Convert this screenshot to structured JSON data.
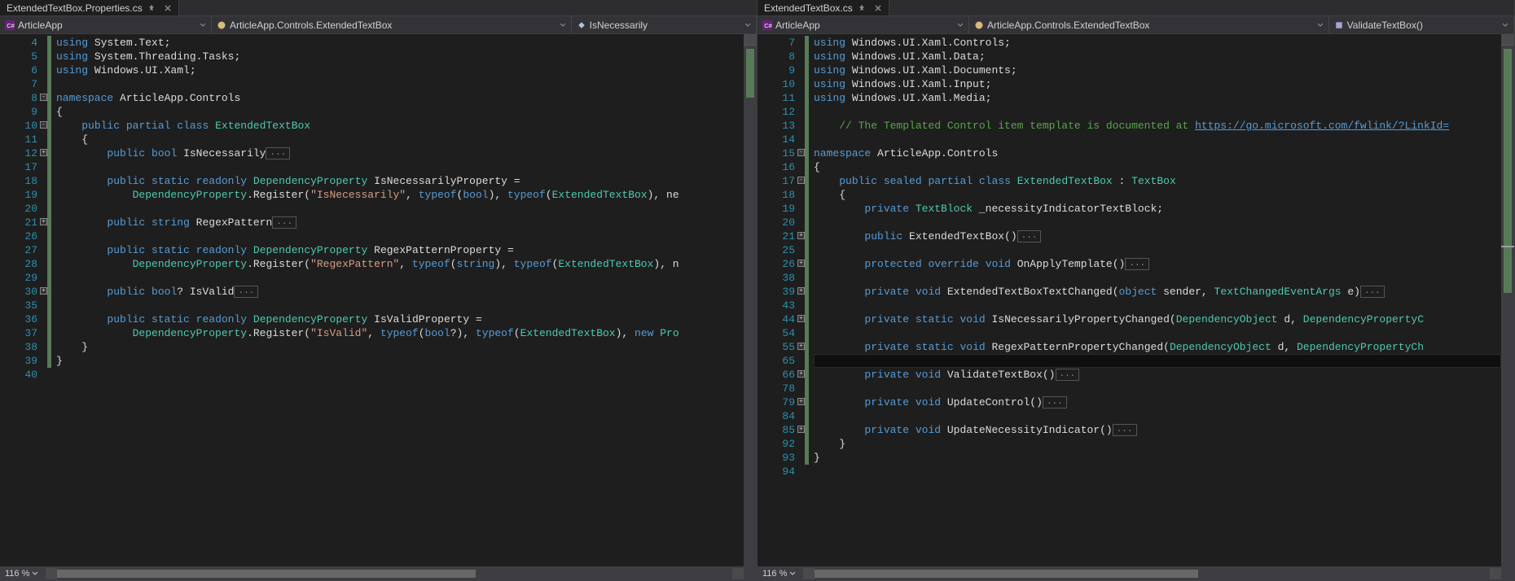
{
  "left": {
    "tab": {
      "title": "ExtendedTextBox.Properties.cs"
    },
    "nav": {
      "project": "ArticleApp",
      "class": "ArticleApp.Controls.ExtendedTextBox",
      "member": "IsNecessarily"
    },
    "zoom": "116 %",
    "lines": [
      {
        "num": 4,
        "green": true,
        "tokens": [
          [
            "kw",
            "using"
          ],
          [
            "pln",
            " System.Text;"
          ]
        ]
      },
      {
        "num": 5,
        "green": true,
        "tokens": [
          [
            "kw",
            "using"
          ],
          [
            "pln",
            " System.Threading.Tasks;"
          ]
        ]
      },
      {
        "num": 6,
        "green": true,
        "tokens": [
          [
            "kw",
            "using"
          ],
          [
            "pln",
            " Windows.UI.Xaml;"
          ]
        ]
      },
      {
        "num": 7,
        "green": true,
        "tokens": []
      },
      {
        "num": 8,
        "green": true,
        "fold": "-",
        "tokens": [
          [
            "kw",
            "namespace"
          ],
          [
            "pln",
            " ArticleApp.Controls"
          ]
        ]
      },
      {
        "num": 9,
        "green": true,
        "tokens": [
          [
            "pln",
            "{"
          ]
        ]
      },
      {
        "num": 10,
        "green": true,
        "fold": "-",
        "tokens": [
          [
            "pln",
            "    "
          ],
          [
            "kw",
            "public"
          ],
          [
            "pln",
            " "
          ],
          [
            "kw",
            "partial"
          ],
          [
            "pln",
            " "
          ],
          [
            "kw",
            "class"
          ],
          [
            "pln",
            " "
          ],
          [
            "cls",
            "ExtendedTextBox"
          ]
        ]
      },
      {
        "num": 11,
        "green": true,
        "tokens": [
          [
            "pln",
            "    {"
          ]
        ]
      },
      {
        "num": 12,
        "green": true,
        "fold": "+",
        "tokens": [
          [
            "pln",
            "        "
          ],
          [
            "kw",
            "public"
          ],
          [
            "pln",
            " "
          ],
          [
            "kw",
            "bool"
          ],
          [
            "pln",
            " IsNecessarily"
          ]
        ],
        "collapsed": "..."
      },
      {
        "num": 17,
        "green": true,
        "tokens": []
      },
      {
        "num": 18,
        "green": true,
        "tokens": [
          [
            "pln",
            "        "
          ],
          [
            "kw",
            "public"
          ],
          [
            "pln",
            " "
          ],
          [
            "kw",
            "static"
          ],
          [
            "pln",
            " "
          ],
          [
            "kw",
            "readonly"
          ],
          [
            "pln",
            " "
          ],
          [
            "cls",
            "DependencyProperty"
          ],
          [
            "pln",
            " IsNecessarilyProperty ="
          ]
        ]
      },
      {
        "num": 19,
        "green": true,
        "tokens": [
          [
            "pln",
            "            "
          ],
          [
            "cls",
            "DependencyProperty"
          ],
          [
            "pln",
            ".Register("
          ],
          [
            "str",
            "\"IsNecessarily\""
          ],
          [
            "pln",
            ", "
          ],
          [
            "kw",
            "typeof"
          ],
          [
            "pln",
            "("
          ],
          [
            "kw",
            "bool"
          ],
          [
            "pln",
            "), "
          ],
          [
            "kw",
            "typeof"
          ],
          [
            "pln",
            "("
          ],
          [
            "cls",
            "ExtendedTextBox"
          ],
          [
            "pln",
            "), ne"
          ]
        ]
      },
      {
        "num": 20,
        "green": true,
        "tokens": []
      },
      {
        "num": 21,
        "green": true,
        "fold": "+",
        "tokens": [
          [
            "pln",
            "        "
          ],
          [
            "kw",
            "public"
          ],
          [
            "pln",
            " "
          ],
          [
            "kw",
            "string"
          ],
          [
            "pln",
            " RegexPattern"
          ]
        ],
        "collapsed": "..."
      },
      {
        "num": 26,
        "green": true,
        "tokens": []
      },
      {
        "num": 27,
        "green": true,
        "tokens": [
          [
            "pln",
            "        "
          ],
          [
            "kw",
            "public"
          ],
          [
            "pln",
            " "
          ],
          [
            "kw",
            "static"
          ],
          [
            "pln",
            " "
          ],
          [
            "kw",
            "readonly"
          ],
          [
            "pln",
            " "
          ],
          [
            "cls",
            "DependencyProperty"
          ],
          [
            "pln",
            " RegexPatternProperty ="
          ]
        ]
      },
      {
        "num": 28,
        "green": true,
        "tokens": [
          [
            "pln",
            "            "
          ],
          [
            "cls",
            "DependencyProperty"
          ],
          [
            "pln",
            ".Register("
          ],
          [
            "str",
            "\"RegexPattern\""
          ],
          [
            "pln",
            ", "
          ],
          [
            "kw",
            "typeof"
          ],
          [
            "pln",
            "("
          ],
          [
            "kw",
            "string"
          ],
          [
            "pln",
            "), "
          ],
          [
            "kw",
            "typeof"
          ],
          [
            "pln",
            "("
          ],
          [
            "cls",
            "ExtendedTextBox"
          ],
          [
            "pln",
            "), n"
          ]
        ]
      },
      {
        "num": 29,
        "green": true,
        "tokens": []
      },
      {
        "num": 30,
        "green": true,
        "fold": "+",
        "tokens": [
          [
            "pln",
            "        "
          ],
          [
            "kw",
            "public"
          ],
          [
            "pln",
            " "
          ],
          [
            "kw",
            "bool"
          ],
          [
            "pln",
            "? IsValid"
          ]
        ],
        "collapsed": "..."
      },
      {
        "num": 35,
        "green": true,
        "tokens": []
      },
      {
        "num": 36,
        "green": true,
        "tokens": [
          [
            "pln",
            "        "
          ],
          [
            "kw",
            "public"
          ],
          [
            "pln",
            " "
          ],
          [
            "kw",
            "static"
          ],
          [
            "pln",
            " "
          ],
          [
            "kw",
            "readonly"
          ],
          [
            "pln",
            " "
          ],
          [
            "cls",
            "DependencyProperty"
          ],
          [
            "pln",
            " IsValidProperty ="
          ]
        ]
      },
      {
        "num": 37,
        "green": true,
        "tokens": [
          [
            "pln",
            "            "
          ],
          [
            "cls",
            "DependencyProperty"
          ],
          [
            "pln",
            ".Register("
          ],
          [
            "str",
            "\"IsValid\""
          ],
          [
            "pln",
            ", "
          ],
          [
            "kw",
            "typeof"
          ],
          [
            "pln",
            "("
          ],
          [
            "kw",
            "bool"
          ],
          [
            "pln",
            "?), "
          ],
          [
            "kw",
            "typeof"
          ],
          [
            "pln",
            "("
          ],
          [
            "cls",
            "ExtendedTextBox"
          ],
          [
            "pln",
            "), "
          ],
          [
            "kw",
            "new"
          ],
          [
            "pln",
            " "
          ],
          [
            "cls",
            "Pro"
          ]
        ]
      },
      {
        "num": 38,
        "green": true,
        "tokens": [
          [
            "pln",
            "    }"
          ]
        ]
      },
      {
        "num": 39,
        "green": true,
        "tokens": [
          [
            "pln",
            "}"
          ]
        ]
      },
      {
        "num": 40,
        "tokens": []
      }
    ]
  },
  "right": {
    "tab": {
      "title": "ExtendedTextBox.cs"
    },
    "nav": {
      "project": "ArticleApp",
      "class": "ArticleApp.Controls.ExtendedTextBox",
      "member": "ValidateTextBox()"
    },
    "zoom": "116 %",
    "lines": [
      {
        "num": 7,
        "green": true,
        "tokens": [
          [
            "kw",
            "using"
          ],
          [
            "pln",
            " Windows.UI.Xaml.Controls;"
          ]
        ]
      },
      {
        "num": 8,
        "green": true,
        "tokens": [
          [
            "kw",
            "using"
          ],
          [
            "pln",
            " Windows.UI.Xaml.Data;"
          ]
        ]
      },
      {
        "num": 9,
        "green": true,
        "tokens": [
          [
            "kw",
            "using"
          ],
          [
            "pln",
            " Windows.UI.Xaml.Documents;"
          ]
        ]
      },
      {
        "num": 10,
        "green": true,
        "tokens": [
          [
            "kw",
            "using"
          ],
          [
            "pln",
            " Windows.UI.Xaml.Input;"
          ]
        ]
      },
      {
        "num": 11,
        "green": true,
        "tokens": [
          [
            "kw",
            "using"
          ],
          [
            "pln",
            " Windows.UI.Xaml.Media;"
          ]
        ]
      },
      {
        "num": 12,
        "green": true,
        "tokens": []
      },
      {
        "num": 13,
        "green": true,
        "tokens": [
          [
            "pln",
            "    "
          ],
          [
            "cmt",
            "// The Templated Control item template is documented at "
          ],
          [
            "lnk",
            "https://go.microsoft.com/fwlink/?LinkId="
          ]
        ]
      },
      {
        "num": 14,
        "green": true,
        "tokens": []
      },
      {
        "num": 15,
        "green": true,
        "fold": "-",
        "tokens": [
          [
            "kw",
            "namespace"
          ],
          [
            "pln",
            " ArticleApp.Controls"
          ]
        ]
      },
      {
        "num": 16,
        "green": true,
        "tokens": [
          [
            "pln",
            "{"
          ]
        ]
      },
      {
        "num": 17,
        "green": true,
        "fold": "-",
        "tokens": [
          [
            "pln",
            "    "
          ],
          [
            "kw",
            "public"
          ],
          [
            "pln",
            " "
          ],
          [
            "kw",
            "sealed"
          ],
          [
            "pln",
            " "
          ],
          [
            "kw",
            "partial"
          ],
          [
            "pln",
            " "
          ],
          [
            "kw",
            "class"
          ],
          [
            "pln",
            " "
          ],
          [
            "cls",
            "ExtendedTextBox"
          ],
          [
            "pln",
            " : "
          ],
          [
            "cls",
            "TextBox"
          ]
        ]
      },
      {
        "num": 18,
        "green": true,
        "tokens": [
          [
            "pln",
            "    {"
          ]
        ]
      },
      {
        "num": 19,
        "green": true,
        "tokens": [
          [
            "pln",
            "        "
          ],
          [
            "kw",
            "private"
          ],
          [
            "pln",
            " "
          ],
          [
            "cls",
            "TextBlock"
          ],
          [
            "pln",
            " _necessityIndicatorTextBlock;"
          ]
        ]
      },
      {
        "num": 20,
        "green": true,
        "tokens": []
      },
      {
        "num": 21,
        "green": true,
        "fold": "+",
        "tokens": [
          [
            "pln",
            "        "
          ],
          [
            "kw",
            "public"
          ],
          [
            "pln",
            " ExtendedTextBox()"
          ]
        ],
        "collapsed": "..."
      },
      {
        "num": 25,
        "green": true,
        "tokens": []
      },
      {
        "num": 26,
        "green": true,
        "fold": "+",
        "tokens": [
          [
            "pln",
            "        "
          ],
          [
            "kw",
            "protected"
          ],
          [
            "pln",
            " "
          ],
          [
            "kw",
            "override"
          ],
          [
            "pln",
            " "
          ],
          [
            "kw",
            "void"
          ],
          [
            "pln",
            " OnApplyTemplate()"
          ]
        ],
        "collapsed": "..."
      },
      {
        "num": 38,
        "green": true,
        "tokens": []
      },
      {
        "num": 39,
        "green": true,
        "fold": "+",
        "tokens": [
          [
            "pln",
            "        "
          ],
          [
            "kw",
            "private"
          ],
          [
            "pln",
            " "
          ],
          [
            "kw",
            "void"
          ],
          [
            "pln",
            " ExtendedTextBoxTextChanged("
          ],
          [
            "kw",
            "object"
          ],
          [
            "pln",
            " sender, "
          ],
          [
            "cls",
            "TextChangedEventArgs"
          ],
          [
            "pln",
            " e)"
          ]
        ],
        "collapsed": "..."
      },
      {
        "num": 43,
        "green": true,
        "tokens": []
      },
      {
        "num": 44,
        "green": true,
        "fold": "+",
        "tokens": [
          [
            "pln",
            "        "
          ],
          [
            "kw",
            "private"
          ],
          [
            "pln",
            " "
          ],
          [
            "kw",
            "static"
          ],
          [
            "pln",
            " "
          ],
          [
            "kw",
            "void"
          ],
          [
            "pln",
            " IsNecessarilyPropertyChanged("
          ],
          [
            "cls",
            "DependencyObject"
          ],
          [
            "pln",
            " d, "
          ],
          [
            "cls",
            "DependencyPropertyC"
          ]
        ]
      },
      {
        "num": 54,
        "green": true,
        "tokens": []
      },
      {
        "num": 55,
        "green": true,
        "fold": "+",
        "tokens": [
          [
            "pln",
            "        "
          ],
          [
            "kw",
            "private"
          ],
          [
            "pln",
            " "
          ],
          [
            "kw",
            "static"
          ],
          [
            "pln",
            " "
          ],
          [
            "kw",
            "void"
          ],
          [
            "pln",
            " RegexPatternPropertyChanged("
          ],
          [
            "cls",
            "DependencyObject"
          ],
          [
            "pln",
            " d, "
          ],
          [
            "cls",
            "DependencyPropertyCh"
          ]
        ]
      },
      {
        "num": 65,
        "green": true,
        "current": true,
        "tokens": []
      },
      {
        "num": 66,
        "green": true,
        "fold": "+",
        "tokens": [
          [
            "pln",
            "        "
          ],
          [
            "kw",
            "private"
          ],
          [
            "pln",
            " "
          ],
          [
            "kw",
            "void"
          ],
          [
            "pln",
            " ValidateTextBox()"
          ]
        ],
        "collapsed": "..."
      },
      {
        "num": 78,
        "green": true,
        "tokens": []
      },
      {
        "num": 79,
        "green": true,
        "fold": "+",
        "tokens": [
          [
            "pln",
            "        "
          ],
          [
            "kw",
            "private"
          ],
          [
            "pln",
            " "
          ],
          [
            "kw",
            "void"
          ],
          [
            "pln",
            " UpdateControl()"
          ]
        ],
        "collapsed": "..."
      },
      {
        "num": 84,
        "green": true,
        "tokens": []
      },
      {
        "num": 85,
        "green": true,
        "fold": "+",
        "tokens": [
          [
            "pln",
            "        "
          ],
          [
            "kw",
            "private"
          ],
          [
            "pln",
            " "
          ],
          [
            "kw",
            "void"
          ],
          [
            "pln",
            " UpdateNecessityIndicator()"
          ]
        ],
        "collapsed": "..."
      },
      {
        "num": 92,
        "green": true,
        "tokens": [
          [
            "pln",
            "    }"
          ]
        ]
      },
      {
        "num": 93,
        "green": true,
        "tokens": [
          [
            "pln",
            "}"
          ]
        ]
      },
      {
        "num": 94,
        "tokens": []
      }
    ]
  }
}
